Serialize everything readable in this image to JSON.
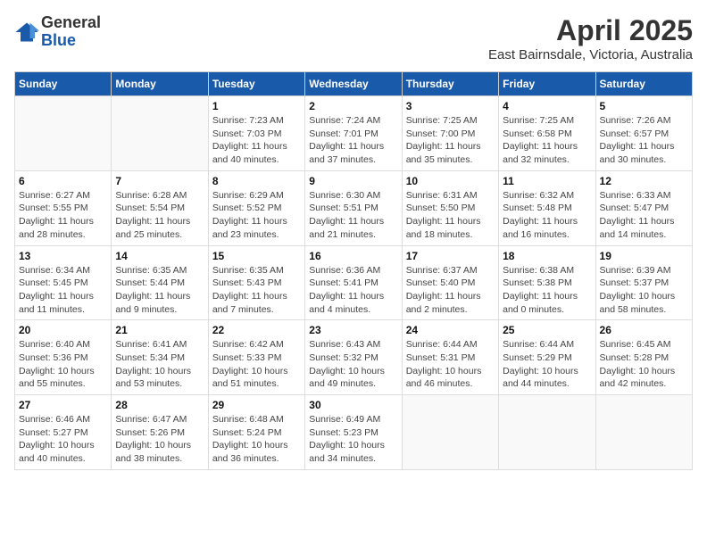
{
  "header": {
    "logo_general": "General",
    "logo_blue": "Blue",
    "title": "April 2025",
    "subtitle": "East Bairnsdale, Victoria, Australia"
  },
  "days_of_week": [
    "Sunday",
    "Monday",
    "Tuesday",
    "Wednesday",
    "Thursday",
    "Friday",
    "Saturday"
  ],
  "weeks": [
    [
      {
        "day": "",
        "info": ""
      },
      {
        "day": "",
        "info": ""
      },
      {
        "day": "1",
        "info": "Sunrise: 7:23 AM\nSunset: 7:03 PM\nDaylight: 11 hours and 40 minutes."
      },
      {
        "day": "2",
        "info": "Sunrise: 7:24 AM\nSunset: 7:01 PM\nDaylight: 11 hours and 37 minutes."
      },
      {
        "day": "3",
        "info": "Sunrise: 7:25 AM\nSunset: 7:00 PM\nDaylight: 11 hours and 35 minutes."
      },
      {
        "day": "4",
        "info": "Sunrise: 7:25 AM\nSunset: 6:58 PM\nDaylight: 11 hours and 32 minutes."
      },
      {
        "day": "5",
        "info": "Sunrise: 7:26 AM\nSunset: 6:57 PM\nDaylight: 11 hours and 30 minutes."
      }
    ],
    [
      {
        "day": "6",
        "info": "Sunrise: 6:27 AM\nSunset: 5:55 PM\nDaylight: 11 hours and 28 minutes."
      },
      {
        "day": "7",
        "info": "Sunrise: 6:28 AM\nSunset: 5:54 PM\nDaylight: 11 hours and 25 minutes."
      },
      {
        "day": "8",
        "info": "Sunrise: 6:29 AM\nSunset: 5:52 PM\nDaylight: 11 hours and 23 minutes."
      },
      {
        "day": "9",
        "info": "Sunrise: 6:30 AM\nSunset: 5:51 PM\nDaylight: 11 hours and 21 minutes."
      },
      {
        "day": "10",
        "info": "Sunrise: 6:31 AM\nSunset: 5:50 PM\nDaylight: 11 hours and 18 minutes."
      },
      {
        "day": "11",
        "info": "Sunrise: 6:32 AM\nSunset: 5:48 PM\nDaylight: 11 hours and 16 minutes."
      },
      {
        "day": "12",
        "info": "Sunrise: 6:33 AM\nSunset: 5:47 PM\nDaylight: 11 hours and 14 minutes."
      }
    ],
    [
      {
        "day": "13",
        "info": "Sunrise: 6:34 AM\nSunset: 5:45 PM\nDaylight: 11 hours and 11 minutes."
      },
      {
        "day": "14",
        "info": "Sunrise: 6:35 AM\nSunset: 5:44 PM\nDaylight: 11 hours and 9 minutes."
      },
      {
        "day": "15",
        "info": "Sunrise: 6:35 AM\nSunset: 5:43 PM\nDaylight: 11 hours and 7 minutes."
      },
      {
        "day": "16",
        "info": "Sunrise: 6:36 AM\nSunset: 5:41 PM\nDaylight: 11 hours and 4 minutes."
      },
      {
        "day": "17",
        "info": "Sunrise: 6:37 AM\nSunset: 5:40 PM\nDaylight: 11 hours and 2 minutes."
      },
      {
        "day": "18",
        "info": "Sunrise: 6:38 AM\nSunset: 5:38 PM\nDaylight: 11 hours and 0 minutes."
      },
      {
        "day": "19",
        "info": "Sunrise: 6:39 AM\nSunset: 5:37 PM\nDaylight: 10 hours and 58 minutes."
      }
    ],
    [
      {
        "day": "20",
        "info": "Sunrise: 6:40 AM\nSunset: 5:36 PM\nDaylight: 10 hours and 55 minutes."
      },
      {
        "day": "21",
        "info": "Sunrise: 6:41 AM\nSunset: 5:34 PM\nDaylight: 10 hours and 53 minutes."
      },
      {
        "day": "22",
        "info": "Sunrise: 6:42 AM\nSunset: 5:33 PM\nDaylight: 10 hours and 51 minutes."
      },
      {
        "day": "23",
        "info": "Sunrise: 6:43 AM\nSunset: 5:32 PM\nDaylight: 10 hours and 49 minutes."
      },
      {
        "day": "24",
        "info": "Sunrise: 6:44 AM\nSunset: 5:31 PM\nDaylight: 10 hours and 46 minutes."
      },
      {
        "day": "25",
        "info": "Sunrise: 6:44 AM\nSunset: 5:29 PM\nDaylight: 10 hours and 44 minutes."
      },
      {
        "day": "26",
        "info": "Sunrise: 6:45 AM\nSunset: 5:28 PM\nDaylight: 10 hours and 42 minutes."
      }
    ],
    [
      {
        "day": "27",
        "info": "Sunrise: 6:46 AM\nSunset: 5:27 PM\nDaylight: 10 hours and 40 minutes."
      },
      {
        "day": "28",
        "info": "Sunrise: 6:47 AM\nSunset: 5:26 PM\nDaylight: 10 hours and 38 minutes."
      },
      {
        "day": "29",
        "info": "Sunrise: 6:48 AM\nSunset: 5:24 PM\nDaylight: 10 hours and 36 minutes."
      },
      {
        "day": "30",
        "info": "Sunrise: 6:49 AM\nSunset: 5:23 PM\nDaylight: 10 hours and 34 minutes."
      },
      {
        "day": "",
        "info": ""
      },
      {
        "day": "",
        "info": ""
      },
      {
        "day": "",
        "info": ""
      }
    ]
  ]
}
